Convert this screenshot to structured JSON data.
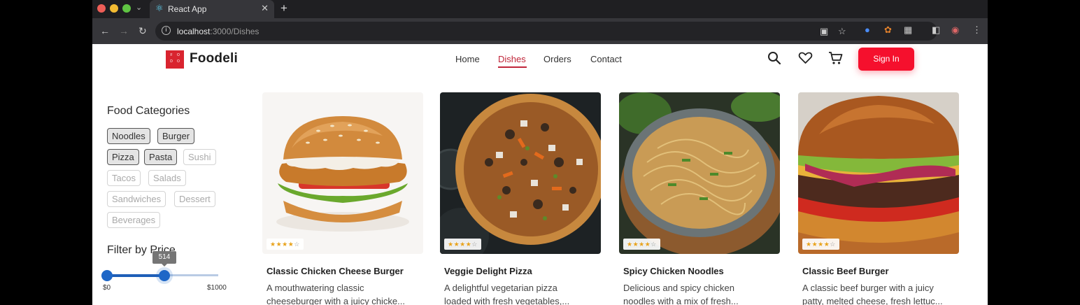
{
  "browser": {
    "tab_title": "React App",
    "new_tab": "+",
    "url_host": "localhost",
    "url_rest": ":3000/Dishes"
  },
  "site": {
    "logo_letters": [
      "F",
      "O",
      "D",
      "O"
    ],
    "brand": "Foodeli",
    "nav": [
      "Home",
      "Dishes",
      "Orders",
      "Contact"
    ],
    "active_nav": "Dishes",
    "signin_label": "Sign In",
    "accent_color": "#f5102d"
  },
  "sidebar": {
    "categories_title": "Food Categories",
    "categories": [
      {
        "label": "Noodles",
        "selected": true
      },
      {
        "label": "Burger",
        "selected": true
      },
      {
        "label": "Pizza",
        "selected": true
      },
      {
        "label": "Pasta",
        "selected": true
      },
      {
        "label": "Sushi",
        "selected": false
      },
      {
        "label": "Tacos",
        "selected": false
      },
      {
        "label": "Salads",
        "selected": false
      },
      {
        "label": "Sandwiches",
        "selected": false
      },
      {
        "label": "Dessert",
        "selected": false
      },
      {
        "label": "Beverages",
        "selected": false
      }
    ],
    "filter_title": "Filter by Price",
    "price_value": "514",
    "price_min_label": "$0",
    "price_max_label": "$1000",
    "price_fraction": 0.514
  },
  "dishes": [
    {
      "title": "Classic Chicken Cheese Burger",
      "line1": "A mouthwatering classic",
      "line2": "cheeseburger with a juicy chicke...",
      "rating": 4
    },
    {
      "title": "Veggie Delight Pizza",
      "line1": "A delightful vegetarian pizza",
      "line2": "loaded with fresh vegetables,...",
      "rating": 4
    },
    {
      "title": "Spicy Chicken Noodles",
      "line1": "Delicious and spicy chicken",
      "line2": "noodles with a mix of fresh...",
      "rating": 4
    },
    {
      "title": "Classic Beef Burger",
      "line1": "A classic beef burger with a juicy",
      "line2": "patty, melted cheese, fresh lettuc...",
      "rating": 4
    }
  ]
}
